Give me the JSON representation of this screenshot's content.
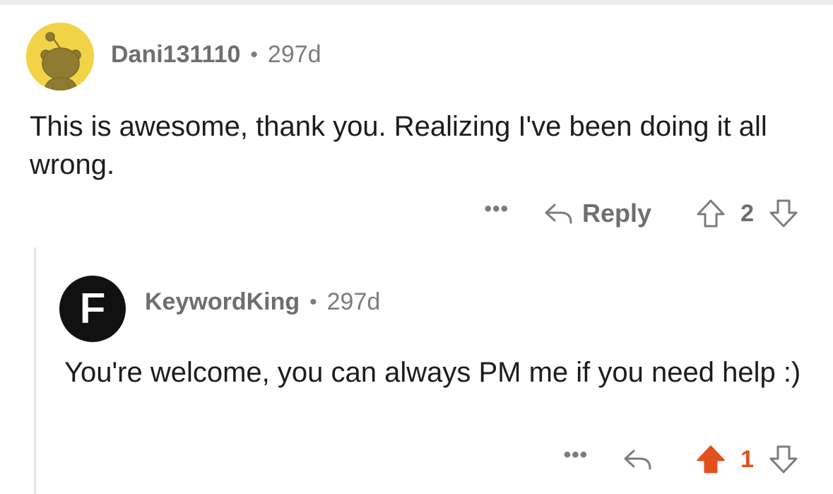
{
  "comments": [
    {
      "username": "Dani131110",
      "age": "297d",
      "text": "This is awesome, thank you. Realizing I've been doing it all wrong.",
      "reply_label": "Reply",
      "score": "2",
      "more": "•••",
      "avatar_icon": "snoo-avatar-icon",
      "avatar_color": "#f2d247"
    },
    {
      "username": "KeywordKing",
      "age": "297d",
      "text": "You're welcome, you can always PM me if you need help :)",
      "avatar_letter": "F",
      "score": "1",
      "more": "•••",
      "upvoted": true,
      "upvote_color": "#e0511e"
    }
  ],
  "separator": "•"
}
